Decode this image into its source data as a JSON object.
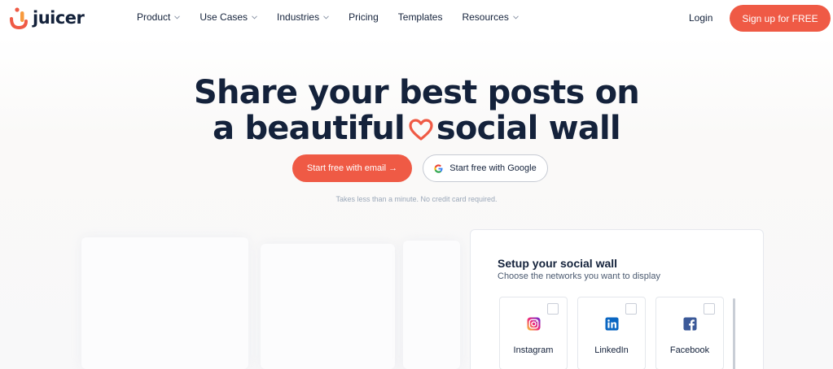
{
  "brand": {
    "name": "juicer"
  },
  "nav": {
    "items": [
      {
        "label": "Product",
        "has_dropdown": true
      },
      {
        "label": "Use Cases",
        "has_dropdown": true
      },
      {
        "label": "Industries",
        "has_dropdown": true
      },
      {
        "label": "Pricing",
        "has_dropdown": false
      },
      {
        "label": "Templates",
        "has_dropdown": false
      },
      {
        "label": "Resources",
        "has_dropdown": true
      }
    ],
    "login_label": "Login",
    "signup_label": "Sign up for FREE"
  },
  "hero": {
    "title_line1": "Share your best posts on",
    "title_line2_pre": "a beautiful",
    "title_line2_post": "social wall",
    "email_button": "Start free with email →",
    "google_button": "Start free with Google",
    "fine_print": "Takes less than a minute. No credit card required."
  },
  "setup_card": {
    "title": "Setup your social wall",
    "subtitle": "Choose the networks you want to display",
    "networks": [
      {
        "label": "Instagram",
        "icon": "instagram-icon",
        "checked": false
      },
      {
        "label": "LinkedIn",
        "icon": "linkedin-icon",
        "checked": false
      },
      {
        "label": "Facebook",
        "icon": "facebook-icon",
        "checked": false
      }
    ]
  },
  "colors": {
    "accent": "#ef5a45",
    "text": "#14223b",
    "muted": "#9aa7b8",
    "linkedin": "#0a66c2",
    "facebook": "#3b5998"
  }
}
